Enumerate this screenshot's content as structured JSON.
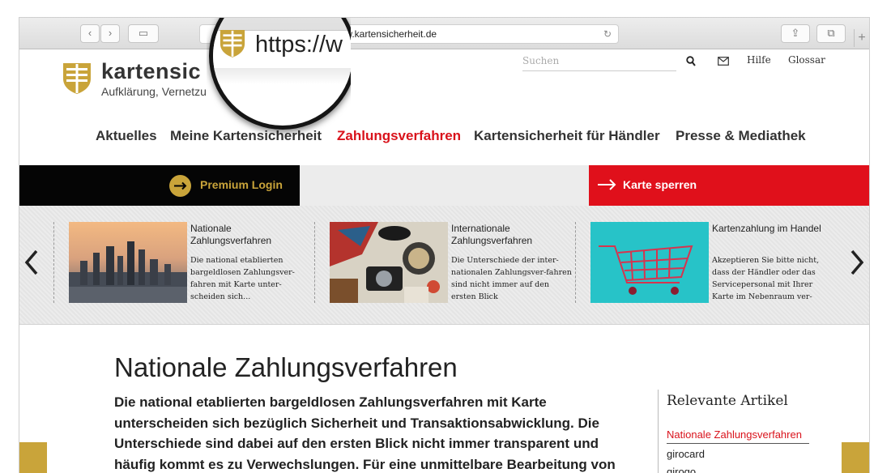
{
  "browser": {
    "url": "www.kartensicherheit.de",
    "magnified_url": "https://w",
    "nav_back": "‹",
    "nav_forward": "›",
    "sidebar": "▭",
    "reload": "↻",
    "share": "⇪",
    "tabs": "⧉",
    "new_tab": "+"
  },
  "header": {
    "logo_name": "kartensic",
    "logo_tagline": "Aufklärung, Vernetzu",
    "search_placeholder": "Suchen",
    "help": "Hilfe",
    "glossary": "Glossar"
  },
  "nav": {
    "items": [
      "Aktuelles",
      "Meine Kartensicherheit",
      "Zahlungsverfahren",
      "Kartensicherheit für Händler",
      "Presse & Mediathek"
    ],
    "active": "Zahlungsverfahren"
  },
  "actions": {
    "premium_login": "Premium Login",
    "block_card": "Karte sperren"
  },
  "carousel": {
    "cards": [
      {
        "title": "Nationale Zahlungsverfahren",
        "text": "Die national etablierten bargeldlosen Zahlungsver-fahren mit Karte unter-scheiden sich..."
      },
      {
        "title": "Internationale Zahlungsverfahren",
        "text": "Die Unterschiede der inter-nationalen Zahlungsver-fahren sind nicht immer auf den ersten Blick"
      },
      {
        "title": "Kartenzahlung im Handel",
        "text": "Akzeptieren Sie bitte nicht, dass der Händler oder das Servicepersonal mit Ihrer Karte im Nebenraum ver-"
      }
    ]
  },
  "article": {
    "title": "Nationale Zahlungsverfahren",
    "lead": "Die national etablierten bargeldlosen Zahlungsverfahren mit Karte unterscheiden sich bezüglich Sicherheit und Transaktionsabwicklung. Die Unterschiede sind dabei auf den ersten Blick nicht immer transparent und häufig kommt es zu Verwechslungen. Für eine unmittelbare Bearbeitung von"
  },
  "sidebar": {
    "title": "Relevante Artikel",
    "links": [
      "Nationale Zahlungsverfahren",
      "girocard",
      "girogo"
    ]
  },
  "colors": {
    "brand_gold": "#c9a43a",
    "brand_red": "#d9121b",
    "black": "#050505"
  }
}
